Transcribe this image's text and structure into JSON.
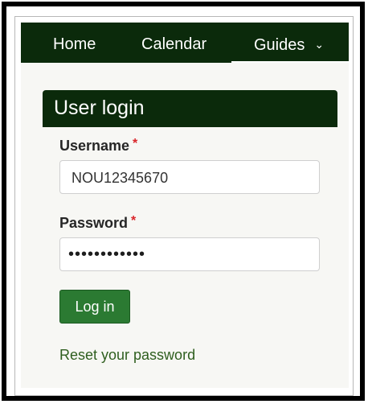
{
  "nav": {
    "items": [
      {
        "label": "Home"
      },
      {
        "label": "Calendar"
      },
      {
        "label": "Guides",
        "chevron": "chevron-down-icon"
      }
    ],
    "chevron_glyph": "⌄",
    "active_item": "Guides"
  },
  "login": {
    "title": "User login",
    "username_label": "Username",
    "username_value": "NOU12345670",
    "password_label": "Password",
    "password_value": "••••••••••••",
    "required_mark": "*",
    "submit_label": "Log in",
    "reset_link": "Reset your password"
  },
  "colors": {
    "nav_background": "#0b2a0b",
    "button_green": "#2b7a32",
    "link_green": "#2e5e1e",
    "required_red": "#d9252a"
  }
}
